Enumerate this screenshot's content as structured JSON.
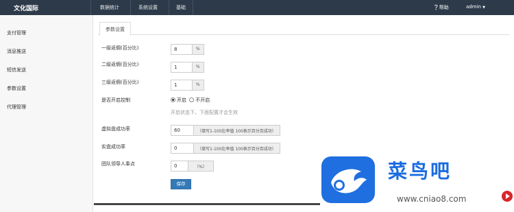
{
  "app": {
    "brand": "文化国际"
  },
  "nav": {
    "items": [
      {
        "label": "数据统计"
      },
      {
        "label": "系统设置"
      },
      {
        "label": "基础"
      }
    ],
    "help": "帮助",
    "user": "admin"
  },
  "sidebar": {
    "items": [
      {
        "label": "支付管理"
      },
      {
        "label": "消息推送"
      },
      {
        "label": "短信发送"
      },
      {
        "label": "参数设置"
      },
      {
        "label": "代理管理"
      }
    ]
  },
  "tabs": [
    {
      "label": "参数设置"
    }
  ],
  "form": {
    "level1": {
      "label": "一级返佣(百分比)",
      "value": "8",
      "unit": "%"
    },
    "level2": {
      "label": "二级返佣(百分比)",
      "value": "1",
      "unit": "%"
    },
    "level3": {
      "label": "三级返佣(百分比)",
      "value": "1",
      "unit": "%"
    },
    "control": {
      "label": "是否开启控制",
      "options": [
        {
          "label": "开启",
          "checked": true
        },
        {
          "label": "不开启",
          "checked": false
        }
      ],
      "hint": "开启状态下，下面配置才会生效"
    },
    "virtual_rate": {
      "label": "虚拟盘成功率",
      "value": "60",
      "addon": "（填写1-100比率值 100表示百分百成功）"
    },
    "real_rate": {
      "label": "实盘成功率",
      "value": "0",
      "addon": "（填写1-100比率值 100表示百分百成功）"
    },
    "team_leader": {
      "label": "团队领导人奉点",
      "value": "0",
      "unit": "（%）"
    },
    "save": "保存"
  },
  "watermark": {
    "name": "菜鸟吧",
    "url": "www.cniao8.com"
  },
  "colors": {
    "navbar": "#2d3a4a",
    "primary": "#337ab7",
    "watermark": "#1a6ce0"
  }
}
